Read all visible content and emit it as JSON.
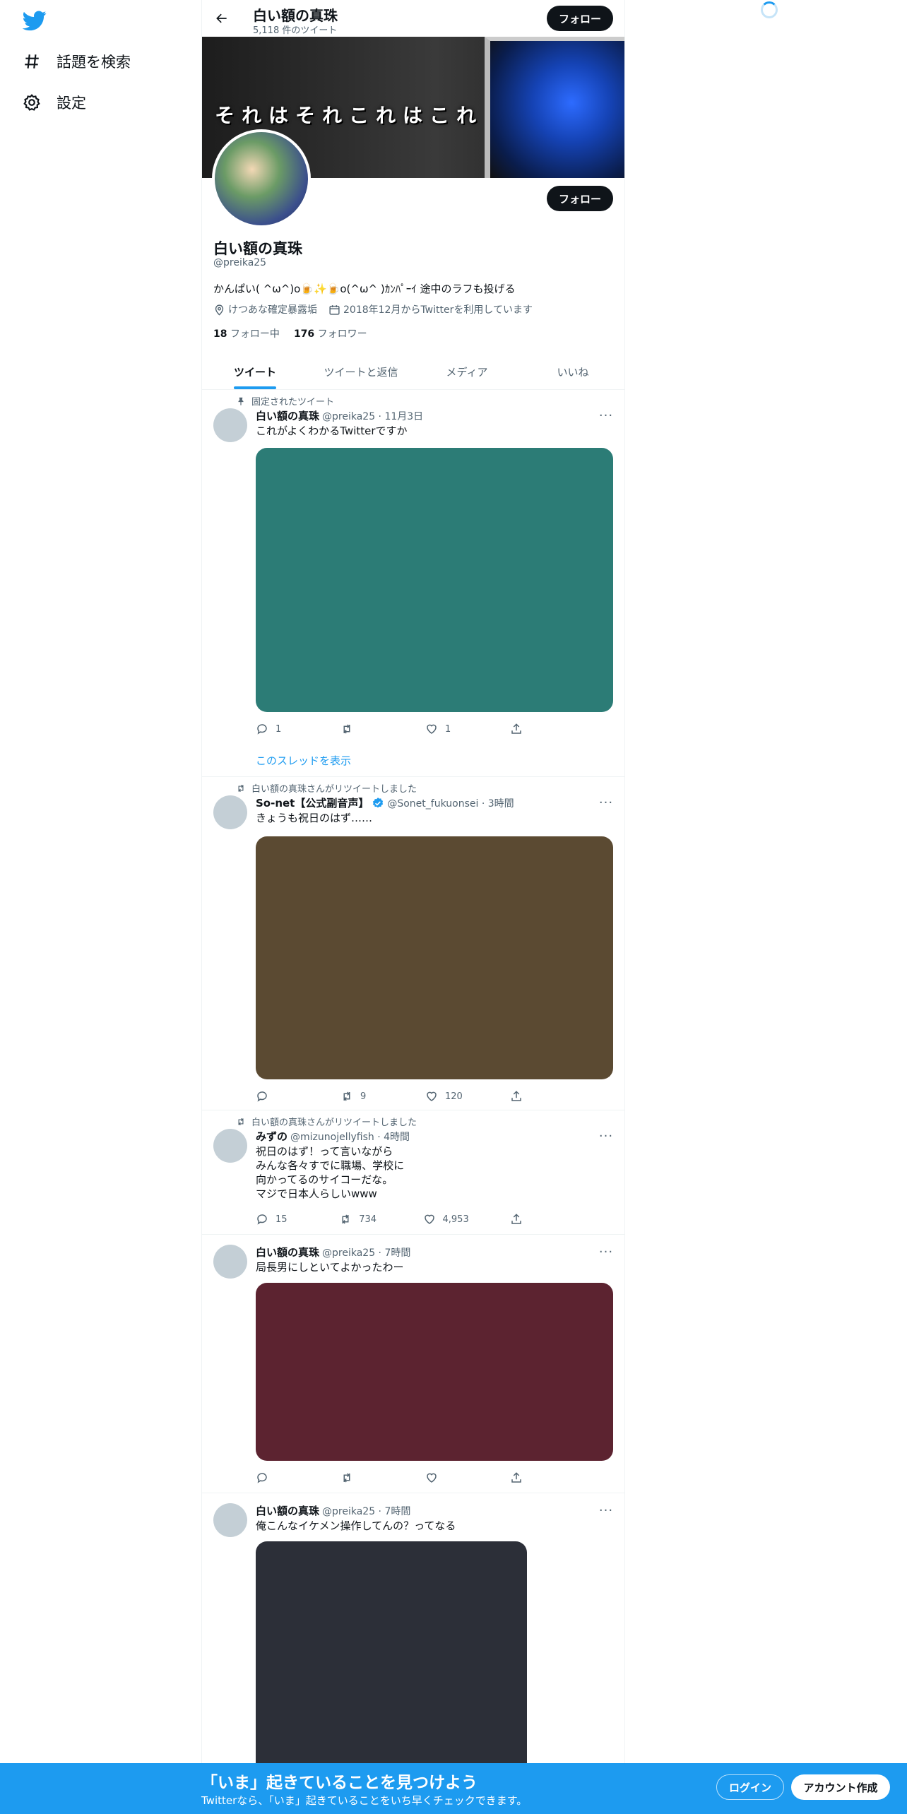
{
  "nav": {
    "explore": "話題を検索",
    "settings": "設定"
  },
  "header": {
    "name": "白い額の真珠",
    "tweet_count": "5,118 件のツイート",
    "follow": "フォロー"
  },
  "banner": {
    "text": "それはそれこれはこれ"
  },
  "profile": {
    "name": "白い額の真珠",
    "handle": "@preika25",
    "bio": "かんぱい( ^ω^)o🍺✨🍺o(^ω^ )ｶﾝﾊﾟｰｲ 途中のラフも投げる",
    "location": "けつあな確定暴露垢",
    "joined": "2018年12月からTwitterを利用しています",
    "following_count": "18",
    "following_label": "フォロー中",
    "followers_count": "176",
    "followers_label": "フォロワー",
    "follow": "フォロー"
  },
  "tabs": [
    "ツイート",
    "ツイートと返信",
    "メディア",
    "いいね"
  ],
  "tweets": [
    {
      "context": "固定されたツイート",
      "name": "白い額の真珠",
      "handle": "@preika25 · 11月3日",
      "text": "これがよくわかるTwitterですか",
      "media_color": "#2c7c76",
      "reply": "1",
      "retweet": "",
      "like": "1",
      "thread": "このスレッドを表示"
    },
    {
      "context": "白い額の真珠さんがリツイートしました",
      "name": "So-net【公式副音声】",
      "handle": "@Sonet_fukuonsei · 3時間",
      "text": "きょうも祝日のはず……",
      "media_color": "#5b4a32",
      "reply": "",
      "retweet": "9",
      "like": "120"
    },
    {
      "context": "白い額の真珠さんがリツイートしました",
      "name": "みずの",
      "handle": "@mizunojellyfish · 4時間",
      "text": "祝日のはず！って言いながら\nみんな各々すでに職場、学校に\n向かってるのサイコーだな。\nマジで日本人らしいwww",
      "reply": "15",
      "retweet": "734",
      "like": "4,953"
    },
    {
      "name": "白い額の真珠",
      "handle": "@preika25 · 7時間",
      "text": "局長男にしといてよかったわー",
      "media_color": "#5c2330",
      "reply": "",
      "retweet": "",
      "like": ""
    },
    {
      "name": "白い額の真珠",
      "handle": "@preika25 · 7時間",
      "text": "俺こんなイケメン操作してんの？ってなる",
      "media_color": "#2c2f38"
    }
  ],
  "bottom": {
    "title": "「いま」起きていることを見つけよう",
    "subtitle": "Twitterなら、「いま」起きていることをいち早くチェックできます。",
    "login": "ログイン",
    "signup": "アカウント作成"
  }
}
